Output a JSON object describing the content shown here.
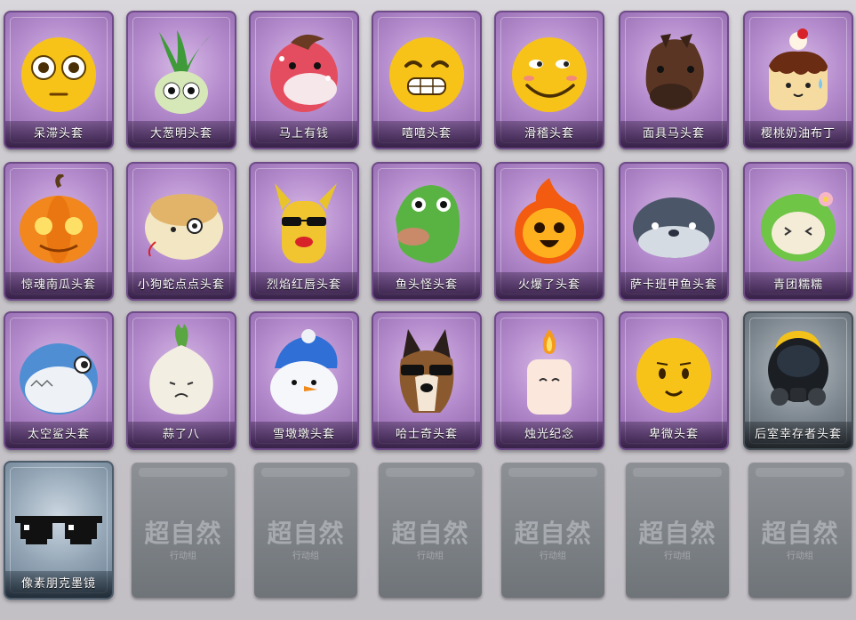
{
  "items": [
    {
      "label": "呆滞头套",
      "icon": "dazed-face-icon",
      "style": "purple"
    },
    {
      "label": "大葱明头套",
      "icon": "scallion-head-icon",
      "style": "purple"
    },
    {
      "label": "马上有钱",
      "icon": "cartoon-horse-icon",
      "style": "purple"
    },
    {
      "label": "嘻嘻头套",
      "icon": "grin-face-icon",
      "style": "purple"
    },
    {
      "label": "滑稽头套",
      "icon": "smirk-face-icon",
      "style": "purple"
    },
    {
      "label": "面具马头套",
      "icon": "horse-mask-icon",
      "style": "purple"
    },
    {
      "label": "樱桃奶油布丁",
      "icon": "cherry-pudding-icon",
      "style": "purple"
    },
    {
      "label": "惊魂南瓜头套",
      "icon": "pumpkin-icon",
      "style": "purple"
    },
    {
      "label": "小狗蛇点点头套",
      "icon": "snake-dog-icon",
      "style": "purple"
    },
    {
      "label": "烈焰红唇头套",
      "icon": "red-lips-mask-icon",
      "style": "purple"
    },
    {
      "label": "鱼头怪头套",
      "icon": "fish-head-icon",
      "style": "purple"
    },
    {
      "label": "火爆了头套",
      "icon": "fire-face-icon",
      "style": "purple"
    },
    {
      "label": "萨卡班甲鱼头套",
      "icon": "armored-fish-icon",
      "style": "purple"
    },
    {
      "label": "青团糯糯",
      "icon": "green-dumpling-icon",
      "style": "purple"
    },
    {
      "label": "太空鲨头套",
      "icon": "space-shark-icon",
      "style": "purple"
    },
    {
      "label": "蒜了八",
      "icon": "garlic-icon",
      "style": "purple"
    },
    {
      "label": "雪墩墩头套",
      "icon": "snowman-icon",
      "style": "purple"
    },
    {
      "label": "哈士奇头套",
      "icon": "husky-sunglasses-icon",
      "style": "purple"
    },
    {
      "label": "烛光纪念",
      "icon": "candle-icon",
      "style": "purple"
    },
    {
      "label": "卑微头套",
      "icon": "humble-face-icon",
      "style": "purple"
    },
    {
      "label": "后室幸存者头套",
      "icon": "gas-mask-icon",
      "style": "grey"
    },
    {
      "label": "像素朋克墨镜",
      "icon": "pixel-sunglasses-icon",
      "style": "slate"
    }
  ],
  "locked_slot": {
    "emblem": "超自然",
    "sub": "行动组"
  },
  "locked_count": 6
}
